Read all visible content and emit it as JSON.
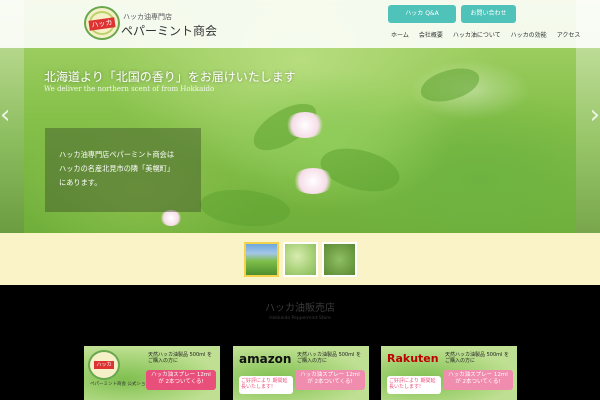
{
  "header": {
    "logo_text": "ハッカ",
    "shop_sub": "ハッカ油専門店",
    "shop_name": "ペパーミント商会",
    "buttons": [
      "ハッカ Q&A",
      "お問い合わせ"
    ],
    "nav": [
      "ホーム",
      "会社概要",
      "ハッカ油について",
      "ハッカの効能",
      "アクセス"
    ]
  },
  "hero": {
    "tagline": "北海道より「北国の香り」をお届けいたします",
    "tagline_en": "We deliver the northern scent of from Hokkaido",
    "info_lines": [
      "ハッカ油専門店ペパーミント商会は",
      "ハッカの名産北見市の隣「美幌町」",
      "にあります。"
    ],
    "prev_arrow": "‹",
    "next_arrow": "›"
  },
  "section": {
    "title": "ハッカ油販売店",
    "subtitle": "Hokkaido Peppermint Store"
  },
  "banners": {
    "b1": {
      "logo_text": "ハッカ",
      "caption": "ペパーミント商会\n公式ショップ",
      "msg": "天然ハッカ油製品 500ml をご購入の方に",
      "pill": "ハッカ油スプレー 12ml が 2本ついてくる!"
    },
    "b2": {
      "brand": "amazon",
      "msg": "天然ハッカ油製品 500ml をご購入の方に",
      "note": "ご好評により 期間延長いたします!",
      "pill": "ハッカ油スプレー 12ml が 2本ついてくる!"
    },
    "b3": {
      "brand": "Rakuten",
      "msg": "天然ハッカ油製品 500ml をご購入の方に",
      "note": "ご好評により 期間延長いたします!",
      "pill": "ハッカ油スプレー 12ml が 2本ついてくる!"
    }
  },
  "colors": {
    "accent": "#4fc3ba",
    "banner_pink": "#e94f7b",
    "thumb_strip": "#faf3c8"
  }
}
